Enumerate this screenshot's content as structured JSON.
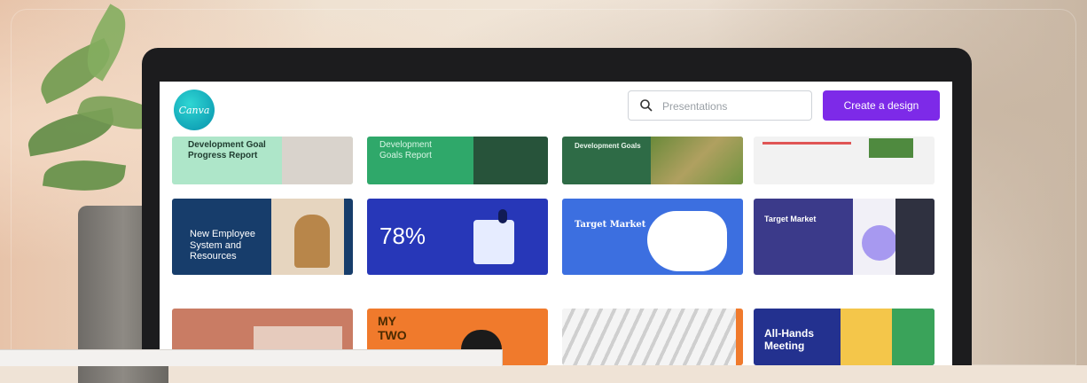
{
  "app": {
    "logo_text": "Canva",
    "search": {
      "placeholder": "Presentations",
      "value": ""
    },
    "create_button": "Create a design",
    "accent_color": "#7d2ae8"
  },
  "templates": {
    "row1": [
      {
        "title": "Development Goal Progress Report",
        "bg": "#aee6c9"
      },
      {
        "title": "Development Goals Report",
        "bg": "#2fa86a"
      },
      {
        "title": "Development Goals",
        "bg": "#2e6b46"
      },
      {
        "title": "",
        "bg": "#f2f2f2"
      }
    ],
    "row2": [
      {
        "title": "New Employee System and Resources",
        "bg": "#173d6b"
      },
      {
        "title": "78%",
        "bg": "#2737b8"
      },
      {
        "title": "Target Market",
        "bg": "#3c6fe0"
      },
      {
        "title": "Target Market",
        "bg": "#5a3ce0"
      }
    ],
    "row3": [
      {
        "title": "",
        "bg": "#c97c64"
      },
      {
        "title": "MY TWO",
        "bg": "#f07a2c"
      },
      {
        "title": "",
        "bg": "#e9e9e9"
      },
      {
        "title": "All-Hands Meeting",
        "bg": "#23318f"
      }
    ]
  },
  "bottom_bar": {
    "text": ""
  }
}
